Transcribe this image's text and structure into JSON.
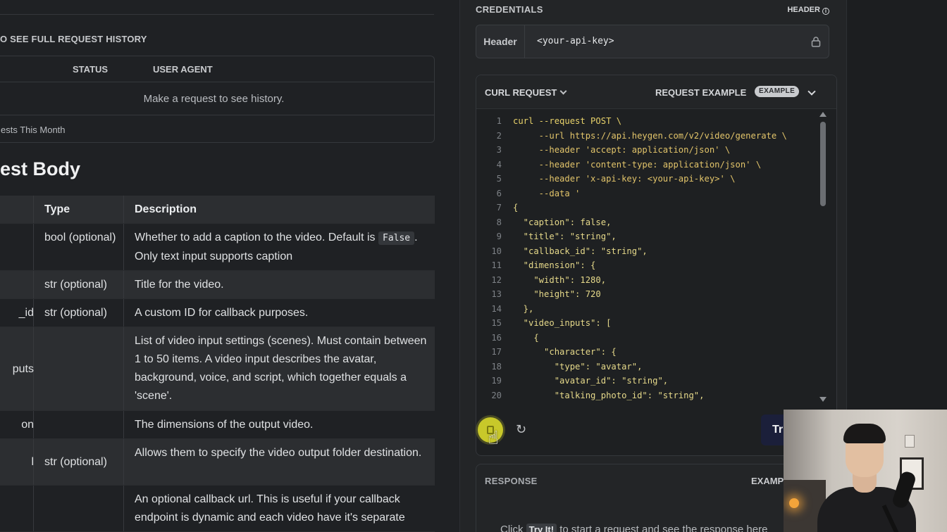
{
  "history": {
    "link_text": "O SEE FULL REQUEST HISTORY",
    "col_status": "STATUS",
    "col_user_agent": "USER AGENT",
    "empty_message": "Make a request to see history.",
    "footer": "ests This Month"
  },
  "section_title": "est Body",
  "params": {
    "headers": {
      "name": "",
      "type": "Type",
      "description": "Description"
    },
    "rows": [
      {
        "name": "",
        "type": "bool (optional)",
        "desc_pre": "Whether to add a caption to the video. Default is",
        "code": "False",
        "desc_post": ". Only text input supports caption"
      },
      {
        "name": "",
        "type": "str (optional)",
        "desc": "Title for the video."
      },
      {
        "name": "_id",
        "type": "str (optional)",
        "desc": "A custom ID for callback purposes."
      },
      {
        "name": "puts",
        "type": "",
        "desc": "List of video input settings (scenes). Must contain between 1 to 50 items. A video input describes the avatar, background, voice, and script, which together equals a 'scene'."
      },
      {
        "name": "on",
        "type": "",
        "desc": "The dimensions of the output video."
      },
      {
        "name": "l",
        "type": "str (optional)",
        "desc": "Allows them to specify the video output folder destination."
      },
      {
        "name": "",
        "type": "",
        "desc": "An optional callback url. This is useful if your callback endpoint is dynamic and each video have it's separate"
      }
    ]
  },
  "credentials": {
    "title": "CREDENTIALS",
    "header_tag": "HEADER",
    "info_glyph": "i",
    "label": "Header",
    "value": "<your-api-key>"
  },
  "curl": {
    "title": "CURL REQUEST",
    "request_example": "REQUEST EXAMPLE",
    "example_pill": "EXAMPLE",
    "lines": [
      {
        "n": "1",
        "t": "curl --request POST \\"
      },
      {
        "n": "2",
        "t": "     --url https://api.heygen.com/v2/video/generate \\"
      },
      {
        "n": "3",
        "t": "     --header 'accept: application/json' \\"
      },
      {
        "n": "4",
        "t": "     --header 'content-type: application/json' \\"
      },
      {
        "n": "5",
        "t": "     --header 'x-api-key: <your-api-key>' \\"
      },
      {
        "n": "6",
        "t": "     --data '"
      },
      {
        "n": "7",
        "t": "{"
      },
      {
        "n": "8",
        "t": "  \"caption\": false,"
      },
      {
        "n": "9",
        "t": "  \"title\": \"string\","
      },
      {
        "n": "10",
        "t": "  \"callback_id\": \"string\","
      },
      {
        "n": "11",
        "t": "  \"dimension\": {"
      },
      {
        "n": "12",
        "t": "    \"width\": 1280,"
      },
      {
        "n": "13",
        "t": "    \"height\": 720"
      },
      {
        "n": "14",
        "t": "  },"
      },
      {
        "n": "15",
        "t": "  \"video_inputs\": ["
      },
      {
        "n": "16",
        "t": "    {"
      },
      {
        "n": "17",
        "t": "      \"character\": {"
      },
      {
        "n": "18",
        "t": "        \"type\": \"avatar\","
      },
      {
        "n": "19",
        "t": "        \"avatar_id\": \"string\","
      },
      {
        "n": "20",
        "t": "        \"talking_photo_id\": \"string\","
      }
    ],
    "try_label": "Tr",
    "reset_glyph": "↻",
    "cursor_glyph": "☝"
  },
  "response": {
    "title": "RESPONSE",
    "example": "EXAMP",
    "hint_pre": "Click",
    "hint_kbd": "Try It!",
    "hint_post": "to start a request and see the response here"
  },
  "colors": {
    "accent_copy": "#c8c82a",
    "try_button": "#1b1f3a",
    "code_yellow": "#e8d26a"
  }
}
